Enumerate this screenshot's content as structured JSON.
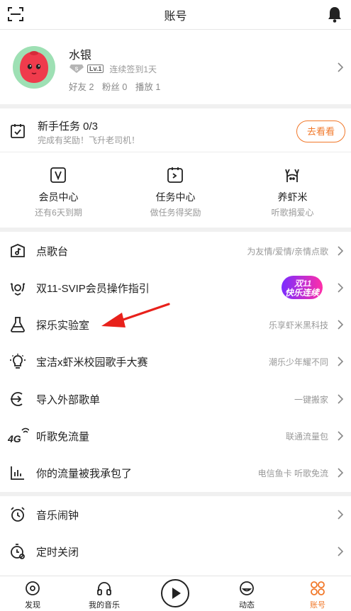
{
  "header": {
    "title": "账号"
  },
  "profile": {
    "name": "水银",
    "level": "Lv.1",
    "checkin": "连续签到1天",
    "friends": "好友 2",
    "fans": "粉丝 0",
    "plays": "播放 1"
  },
  "task": {
    "title": "新手任务 0/3",
    "subtitle": "完成有奖励！飞升老司机！",
    "button": "去看看"
  },
  "quick": [
    {
      "title": "会员中心",
      "sub": "还有6天到期",
      "icon": "vip-icon"
    },
    {
      "title": "任务中心",
      "sub": "做任务得奖励",
      "icon": "task-icon"
    },
    {
      "title": "养虾米",
      "sub": "听歌捐爱心",
      "icon": "shrimp-icon"
    }
  ],
  "menu": [
    {
      "label": "点歌台",
      "hint": "为友情/爱情/亲情点歌",
      "icon": "song-request-icon"
    },
    {
      "label": "双11-SVIP会员操作指引",
      "hint": "",
      "icon": "vip-guide-icon",
      "banner": [
        "双11",
        "快乐连续"
      ]
    },
    {
      "label": "探乐实验室",
      "hint": "乐享虾米黑科技",
      "icon": "flask-icon"
    },
    {
      "label": "宝洁x虾米校园歌手大赛",
      "hint": "潮乐少年耀不同",
      "icon": "lightbulb-icon"
    },
    {
      "label": "导入外部歌单",
      "hint": "一键搬家",
      "icon": "import-icon"
    },
    {
      "label": "听歌免流量",
      "hint": "联通流量包",
      "icon": "4g-icon"
    },
    {
      "label": "你的流量被我承包了",
      "hint": "电信鱼卡 听歌免流",
      "icon": "data-chart-icon"
    },
    {
      "label": "音乐闹钟",
      "hint": "",
      "icon": "alarm-icon"
    },
    {
      "label": "定时关闭",
      "hint": "",
      "icon": "timer-icon"
    }
  ],
  "nav": [
    {
      "label": "发现",
      "icon": "discover-icon"
    },
    {
      "label": "我的音乐",
      "icon": "headphones-icon"
    },
    {
      "label": "动态",
      "icon": "feed-icon"
    },
    {
      "label": "账号",
      "icon": "account-icon"
    }
  ],
  "colors": {
    "accent": "#f1782a",
    "annotation": "#e8211b"
  }
}
